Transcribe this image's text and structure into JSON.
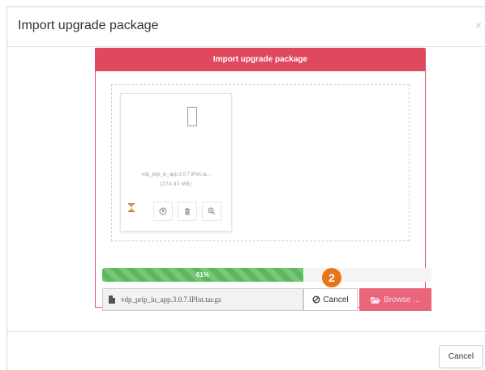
{
  "dialog": {
    "title": "Import upgrade package",
    "close_glyph": "×"
  },
  "panel": {
    "header": "Import upgrade package"
  },
  "file_card": {
    "file_name": "vdp_prip_iu_app.3.0.7.IPInt.ta...",
    "file_size": "(274.83 MB)",
    "icons": [
      "file-icon",
      "hourglass-icon",
      "upload-icon",
      "trash-icon",
      "zoom-icon"
    ]
  },
  "progress": {
    "label": "61%",
    "value": 0.61
  },
  "file_input": {
    "value": "vdp_prip_iu_app.3.0.7.IPInt.tar.gz"
  },
  "buttons": {
    "cancel_label": "Cancel",
    "browse_label": "Browse ...",
    "footer_cancel_label": "Cancel"
  },
  "annotation": {
    "step_number": "2"
  },
  "colors": {
    "panel_header": "#e0485e",
    "progress": "#5cb85c",
    "browse": "#e8657a",
    "badge": "#e8751a"
  }
}
